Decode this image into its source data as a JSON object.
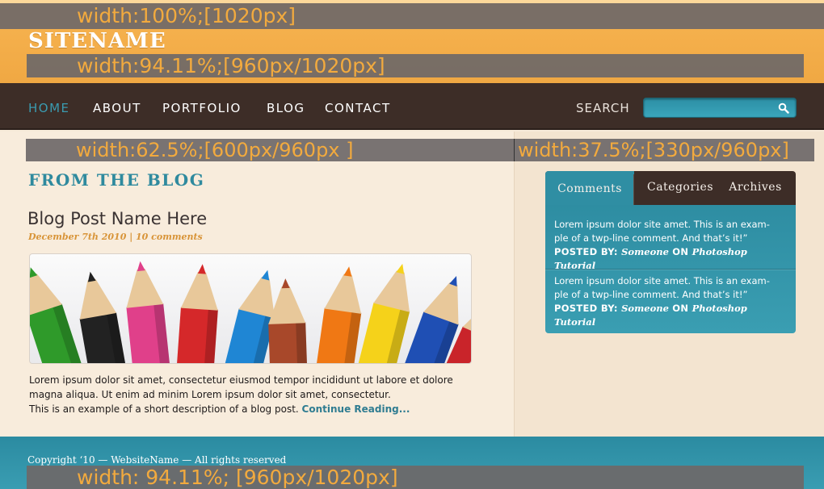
{
  "header": {
    "sitename": "SITENAME",
    "overlay_full": "width:100%;[1020px]",
    "overlay_inner": "width:94.11%;[960px/1020px]"
  },
  "nav": {
    "items": [
      {
        "label": "HOME",
        "active": true
      },
      {
        "label": "ABOUT",
        "active": false
      },
      {
        "label": "PORTFOLIO",
        "active": false
      },
      {
        "label": "BLOG",
        "active": false
      },
      {
        "label": "CONTACT",
        "active": false
      }
    ],
    "search_label": "SEARCH",
    "search_value": ""
  },
  "content": {
    "overlay_main": "width:62.5%;[600px/960px ]",
    "overlay_side": "width:37.5%;[330px/960px]",
    "section_title": "FROM THE BLOG",
    "post": {
      "title": "Blog Post Name Here",
      "meta": "December 7th 2010 | 10 comments",
      "body_line1": "Lorem ipsum dolor sit amet, consectetur eiusmod tempor incididunt ut labore et dolore",
      "body_line2": "magna aliqua. Ut enim ad minim Lorem ipsum dolor sit amet, consectetur.",
      "body_line3": "This is an example of a short description of a blog post.",
      "read_more": "Continue Reading..."
    }
  },
  "sidebar": {
    "tabs": [
      {
        "label": "Comments",
        "active": true
      },
      {
        "label": "Categories",
        "active": false
      },
      {
        "label": "Archives",
        "active": false
      }
    ],
    "comments": [
      {
        "text_line1": "Lorem ipsum dolor site amet. This is an exam-",
        "text_line2": "ple of a twp-line comment. And that’s it!”",
        "posted_by": "POSTED BY:",
        "author": "Someone",
        "on": "ON",
        "post": "Photoshop Tutorial"
      },
      {
        "text_line1": "Lorem ipsum dolor site amet. This is an exam-",
        "text_line2": "ple of a twp-line comment. And that’s it!”",
        "posted_by": "POSTED BY:",
        "author": "Someone",
        "on": "ON",
        "post": "Photoshop Tutorial"
      }
    ]
  },
  "footer": {
    "copyright": "Copyright ‘10 — WebsiteName — All rights reserved",
    "overlay": "width: 94.11%; [960px/1020px]"
  },
  "colors": {
    "header_orange": "#f0a843",
    "nav_brown": "#3d2d27",
    "accent_teal": "#2f8ea3",
    "meta_orange": "#d89438",
    "overlay_text": "#f2aa3e"
  },
  "pencils": [
    {
      "color": "#2f9a2a"
    },
    {
      "color": "#222222"
    },
    {
      "color": "#e0408a"
    },
    {
      "color": "#d5282a"
    },
    {
      "color": "#1f86d4"
    },
    {
      "color": "#a8482a"
    },
    {
      "color": "#f07814"
    },
    {
      "color": "#f5d21a"
    },
    {
      "color": "#1f4fb4"
    },
    {
      "color": "#c9242a"
    }
  ]
}
